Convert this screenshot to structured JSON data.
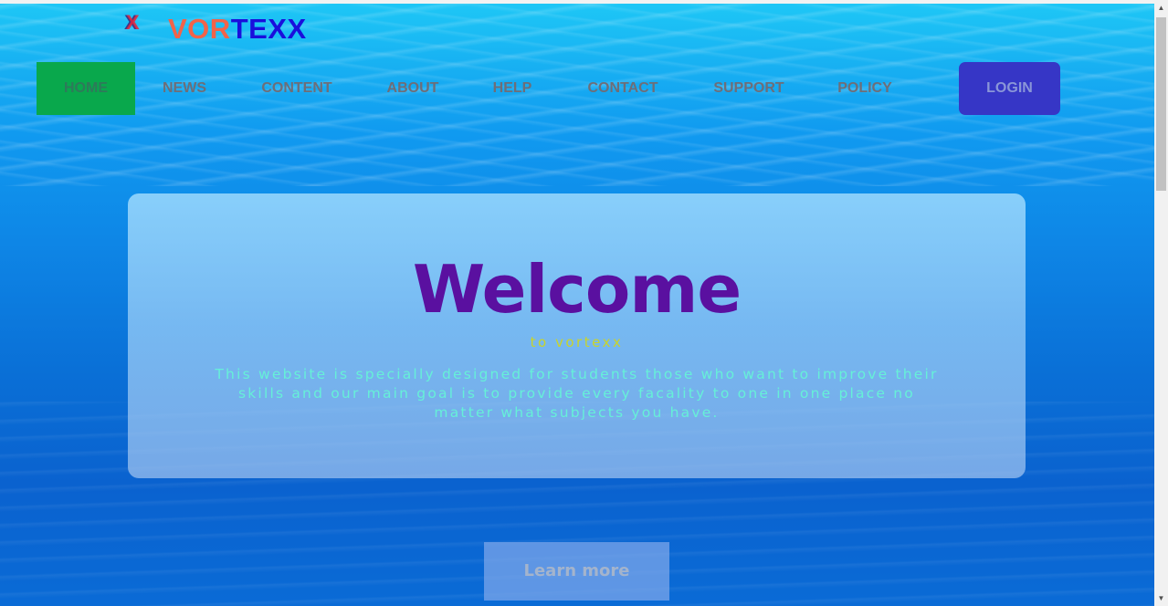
{
  "brand": {
    "logo_glyph": "X",
    "name_part1": "VOR",
    "name_part2": "TEXX"
  },
  "nav": {
    "items": [
      {
        "label": "HOME",
        "active": true
      },
      {
        "label": "NEWS"
      },
      {
        "label": "CONTENT"
      },
      {
        "label": "ABOUT"
      },
      {
        "label": "HELP"
      },
      {
        "label": "CONTACT"
      },
      {
        "label": "SUPPORT"
      },
      {
        "label": "POLICY"
      }
    ],
    "login_label": "LOGIN"
  },
  "hero": {
    "title": "Welcome",
    "tagline": "to vortexx",
    "description": "This website is specially designed for students those who want to improve their skills and our main goal is to provide every facality to one in one place no matter what subjects you have.",
    "cta_label": "Learn more"
  },
  "colors": {
    "active_nav": "#09a84c",
    "login_button": "#3636c6",
    "title": "#5a10a0",
    "brand_part1": "#f2634a",
    "brand_part2": "#1a0fdc"
  },
  "icons": {
    "scroll_up": "triangle-up-icon",
    "scroll_down": "triangle-down-icon"
  }
}
